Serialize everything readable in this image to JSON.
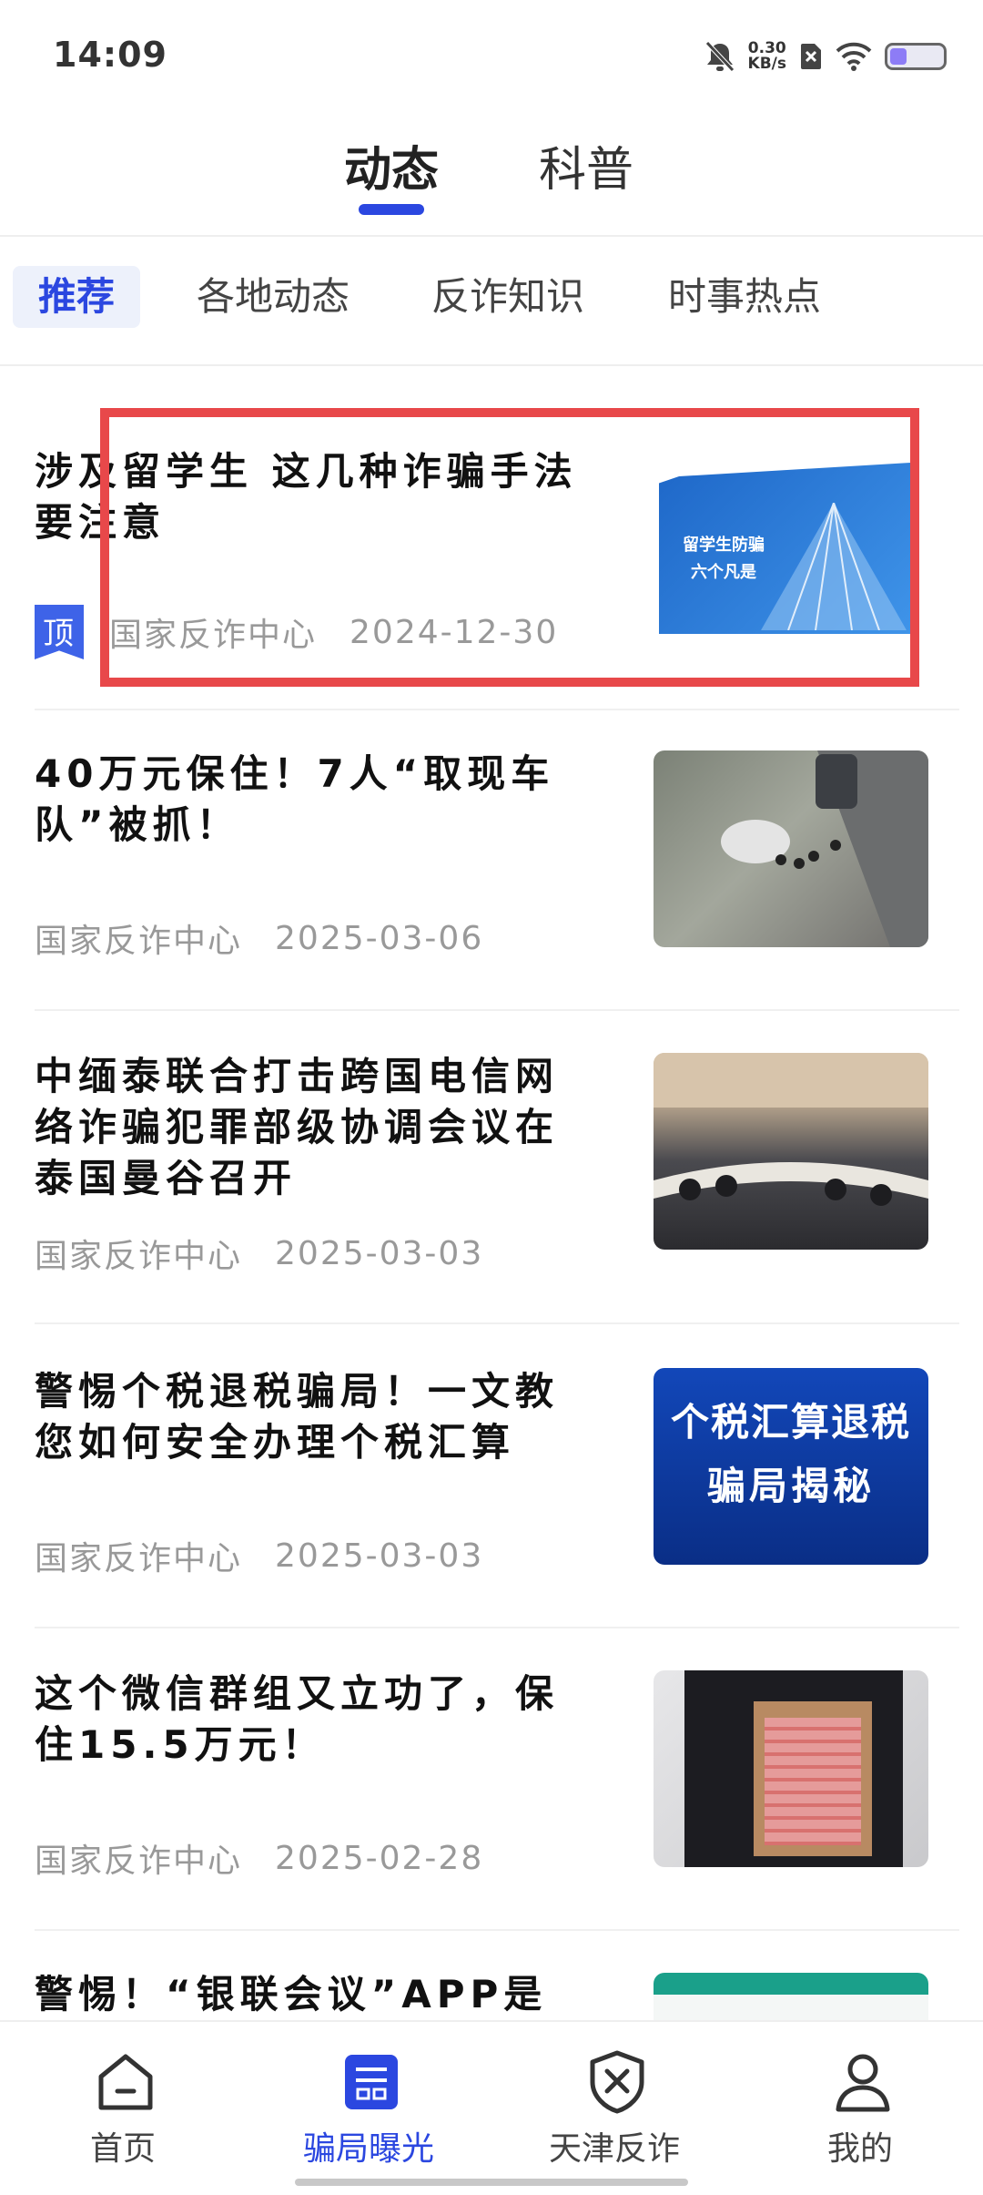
{
  "status_bar": {
    "time": "14:09",
    "net_speed_value": "0.30",
    "net_speed_unit": "KB/s",
    "icons": [
      "bell-off-icon",
      "network-speed-icon",
      "sim-x-icon",
      "wifi-icon",
      "battery-icon"
    ]
  },
  "top_tabs": {
    "items": [
      {
        "label": "动态",
        "active": true
      },
      {
        "label": "科普",
        "active": false
      }
    ]
  },
  "category_tabs": {
    "items": [
      {
        "label": "推荐",
        "active": true
      },
      {
        "label": "各地动态",
        "active": false
      },
      {
        "label": "反诈知识",
        "active": false
      },
      {
        "label": "时事热点",
        "active": false
      }
    ]
  },
  "news": [
    {
      "title": "涉及留学生 这几种诈骗手法要注意",
      "pinned": true,
      "pin_label": "顶",
      "source": "国家反诈中心",
      "date": "2024-12-30",
      "thumb_text": [
        "留学生防骗",
        "六个凡是"
      ]
    },
    {
      "title": "40万元保住！7人“取现车队”被抓！",
      "source": "国家反诈中心",
      "date": "2025-03-06"
    },
    {
      "title": "中缅泰联合打击跨国电信网络诈骗犯罪部级协调会议在泰国曼谷召开",
      "source": "国家反诈中心",
      "date": "2025-03-03"
    },
    {
      "title": "警惕个税退税骗局！一文教您如何安全办理个税汇算",
      "source": "国家反诈中心",
      "date": "2025-03-03",
      "thumb_text": [
        "个税汇算退税",
        "骗局揭秘"
      ]
    },
    {
      "title": "这个微信群组又立功了，保住15.5万元！",
      "source": "国家反诈中心",
      "date": "2025-02-28"
    },
    {
      "title": "警惕！“银联会议”APP是诈"
    }
  ],
  "bottom_nav": {
    "items": [
      {
        "label": "首页",
        "icon": "home-icon",
        "active": false
      },
      {
        "label": "骗局曝光",
        "icon": "scam-exposure-icon",
        "active": true
      },
      {
        "label": "天津反诈",
        "icon": "shield-icon",
        "active": false
      },
      {
        "label": "我的",
        "icon": "profile-icon",
        "active": false
      }
    ]
  },
  "colors": {
    "accent": "#2b47e0",
    "highlight_box": "#e8484a",
    "meta_text": "#999999"
  }
}
